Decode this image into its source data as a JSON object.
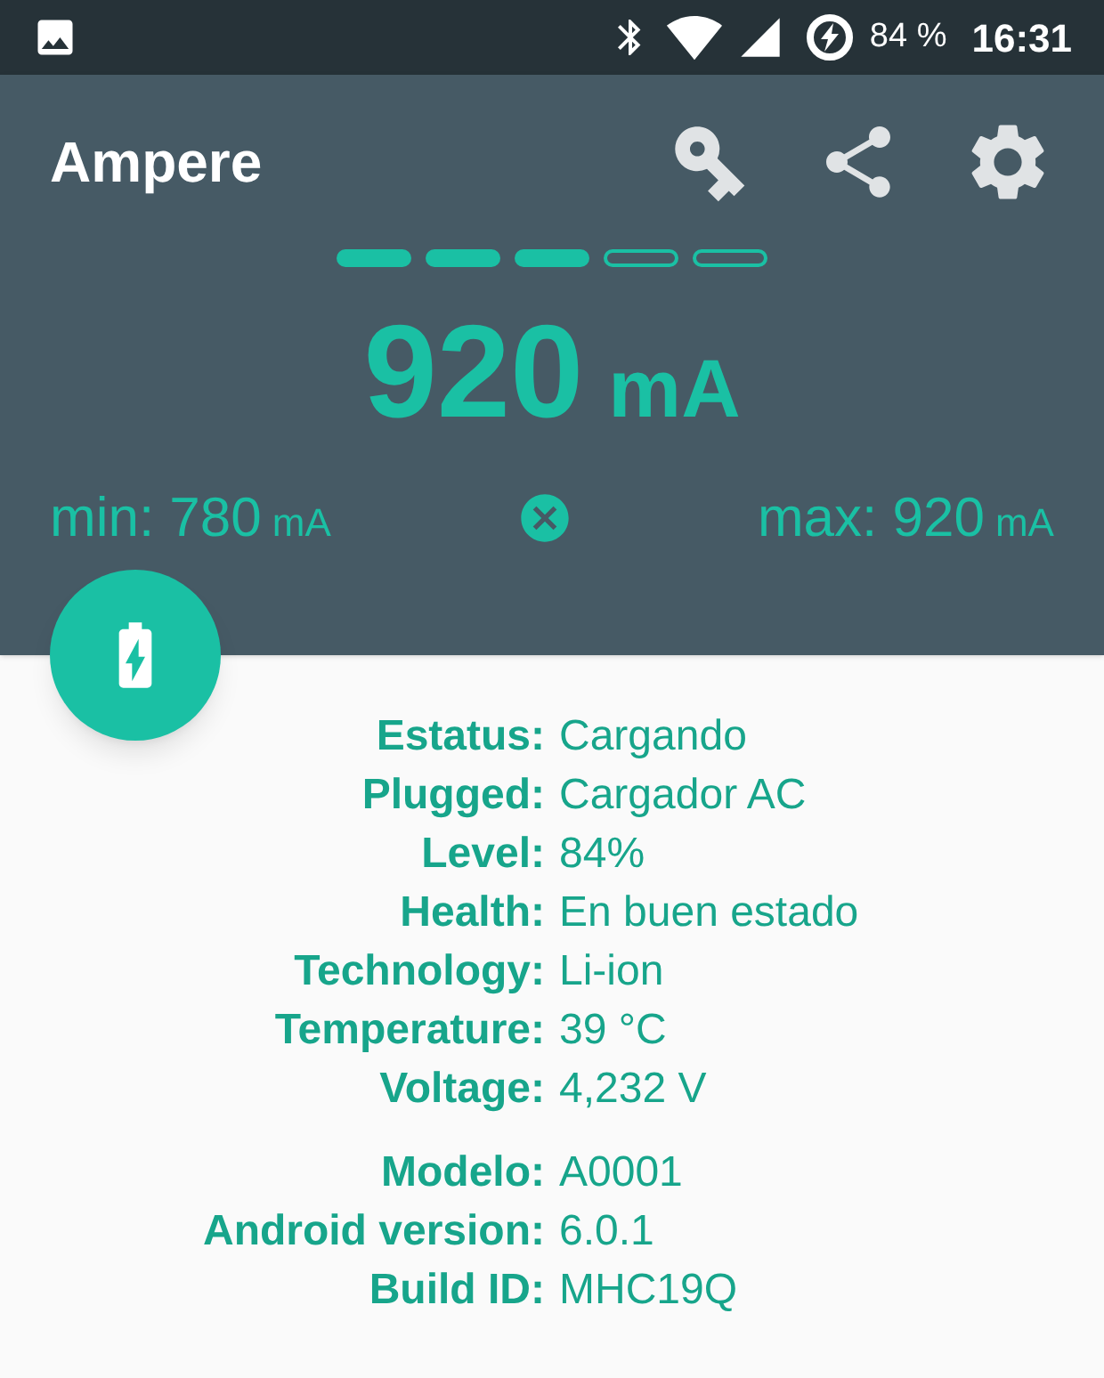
{
  "status_bar": {
    "battery": "84 %",
    "time": "16:31"
  },
  "app_bar": {
    "title": "Ampere"
  },
  "meter": {
    "segments": [
      {
        "filled": true
      },
      {
        "filled": true
      },
      {
        "filled": true
      },
      {
        "filled": false
      },
      {
        "filled": false
      }
    ],
    "current": "920",
    "unit": "mA",
    "min_label": "min: 780",
    "min_unit": "mA",
    "max_label": "max: 920",
    "max_unit": "mA"
  },
  "details": [
    [
      {
        "label": "Estatus:",
        "value": "Cargando"
      },
      {
        "label": "Plugged:",
        "value": "Cargador AC"
      },
      {
        "label": "Level:",
        "value": "84%"
      },
      {
        "label": "Health:",
        "value": "En buen estado"
      },
      {
        "label": "Technology:",
        "value": "Li-ion"
      },
      {
        "label": "Temperature:",
        "value": "39 °C"
      },
      {
        "label": "Voltage:",
        "value": "4,232 V"
      }
    ],
    [
      {
        "label": "Modelo:",
        "value": "A0001"
      },
      {
        "label": "Android version:",
        "value": "6.0.1"
      },
      {
        "label": "Build ID:",
        "value": "MHC19Q"
      }
    ]
  ]
}
